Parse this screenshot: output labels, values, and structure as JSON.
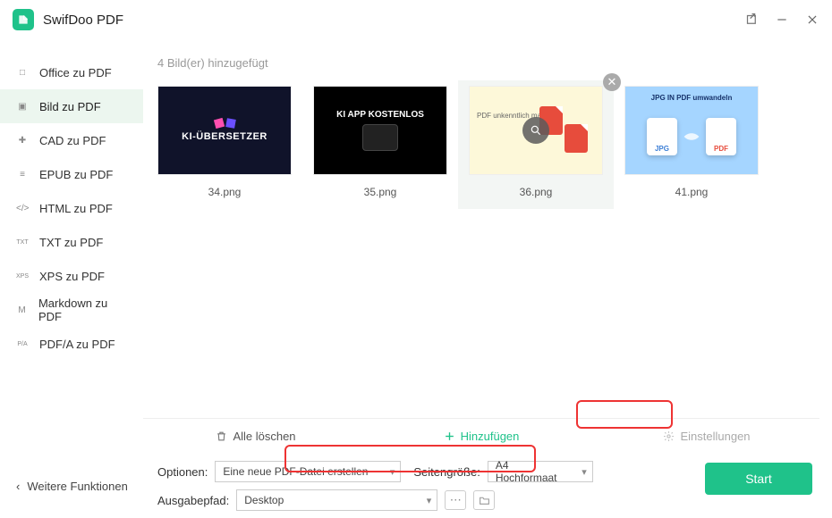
{
  "app": {
    "title": "SwifDoo PDF"
  },
  "sidebar": {
    "items": [
      {
        "label": "Office zu PDF",
        "icon": "□"
      },
      {
        "label": "Bild zu PDF",
        "icon": "▣",
        "active": true
      },
      {
        "label": "CAD zu PDF",
        "icon": "✚"
      },
      {
        "label": "EPUB zu PDF",
        "icon": "≡"
      },
      {
        "label": "HTML zu PDF",
        "icon": "</>"
      },
      {
        "label": "TXT zu PDF",
        "icon": "TXT"
      },
      {
        "label": "XPS zu PDF",
        "icon": "XPS"
      },
      {
        "label": "Markdown zu PDF",
        "icon": "M"
      },
      {
        "label": "PDF/A zu PDF",
        "icon": "P/A"
      }
    ],
    "more_label": "Weitere Funktionen"
  },
  "status": {
    "count_text": "4 Bild(er) hinzugefügt"
  },
  "thumbs": [
    {
      "name": "34.png",
      "visual": "KI-ÜBERSETZER"
    },
    {
      "name": "35.png",
      "visual": "KI APP KOSTENLOS"
    },
    {
      "name": "36.png",
      "visual": "PDF unkenntlich machen",
      "hover": true
    },
    {
      "name": "41.png",
      "visual": "JPG IN PDF umwandeln"
    }
  ],
  "actions": {
    "delete_all": "Alle löschen",
    "add": "Hinzufügen",
    "settings": "Einstellungen"
  },
  "options": {
    "options_label": "Optionen:",
    "options_value": "Eine neue PDF-Datei erstellen",
    "pagesize_label": "Seitengröße:",
    "pagesize_value": "A4 Hochformaat",
    "output_label": "Ausgabepfad:",
    "output_value": "Desktop"
  },
  "start": {
    "label": "Start"
  }
}
